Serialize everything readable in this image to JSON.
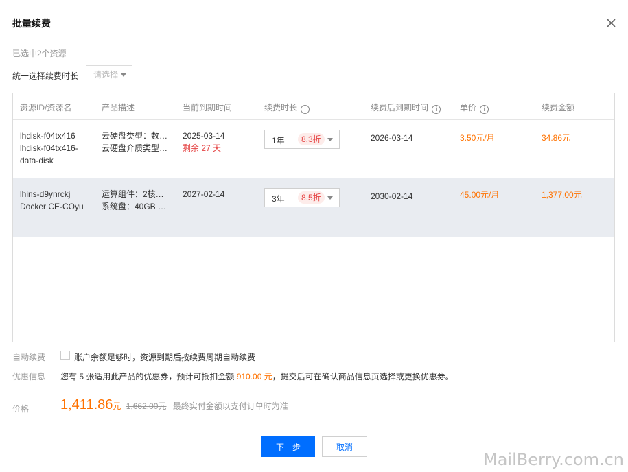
{
  "dialog": {
    "title": "批量续费",
    "selected_count": "已选中2个资源",
    "unified_label": "统一选择续费时长",
    "unified_placeholder": "请选择"
  },
  "table": {
    "headers": [
      "资源ID/资源名",
      "产品描述",
      "当前到期时间",
      "续费时长",
      "续费后到期时间",
      "单价",
      "续费金额"
    ],
    "rows": [
      {
        "id_lines": [
          "lhdisk-f04tx416",
          "lhdisk-f04tx416-",
          "data-disk"
        ],
        "desc_lines": [
          "云硬盘类型：数…",
          "云硬盘介质类型…"
        ],
        "expire": "2025-03-14",
        "remaining": "剩余 27 天",
        "duration": "1年",
        "discount": "8.3折",
        "new_expire": "2026-03-14",
        "unit_price": "3.50元/月",
        "amount": "34.86元"
      },
      {
        "id_lines": [
          "lhins-d9ynrckj",
          "Docker CE-COyu"
        ],
        "desc_lines": [
          "运算组件：2核…",
          "系统盘：40GB …"
        ],
        "expire": "2027-02-14",
        "duration": "3年",
        "discount": "8.5折",
        "new_expire": "2030-02-14",
        "unit_price": "45.00元/月",
        "amount": "1,377.00元"
      }
    ]
  },
  "auto_renew": {
    "label": "自动续费",
    "text": "账户余额足够时，资源到期后按续费周期自动续费"
  },
  "coupon": {
    "label": "优惠信息",
    "text_before": "您有 5 张适用此产品的优惠券，预计可抵扣金额",
    "amount": "910.00 元",
    "text_after": "，提交后可在确认商品信息页选择或更换优惠券。"
  },
  "price": {
    "label": "价格",
    "value": "1,411.86",
    "unit": "元",
    "original": "1,662.00元",
    "note": "最终实付金额以支付订单时为准"
  },
  "buttons": {
    "next": "下一步",
    "cancel": "取消"
  },
  "watermark": "MailBerry.com.cn",
  "colors": {
    "primary": "#006eff",
    "price": "#ff7200",
    "warning": "#e54545"
  }
}
